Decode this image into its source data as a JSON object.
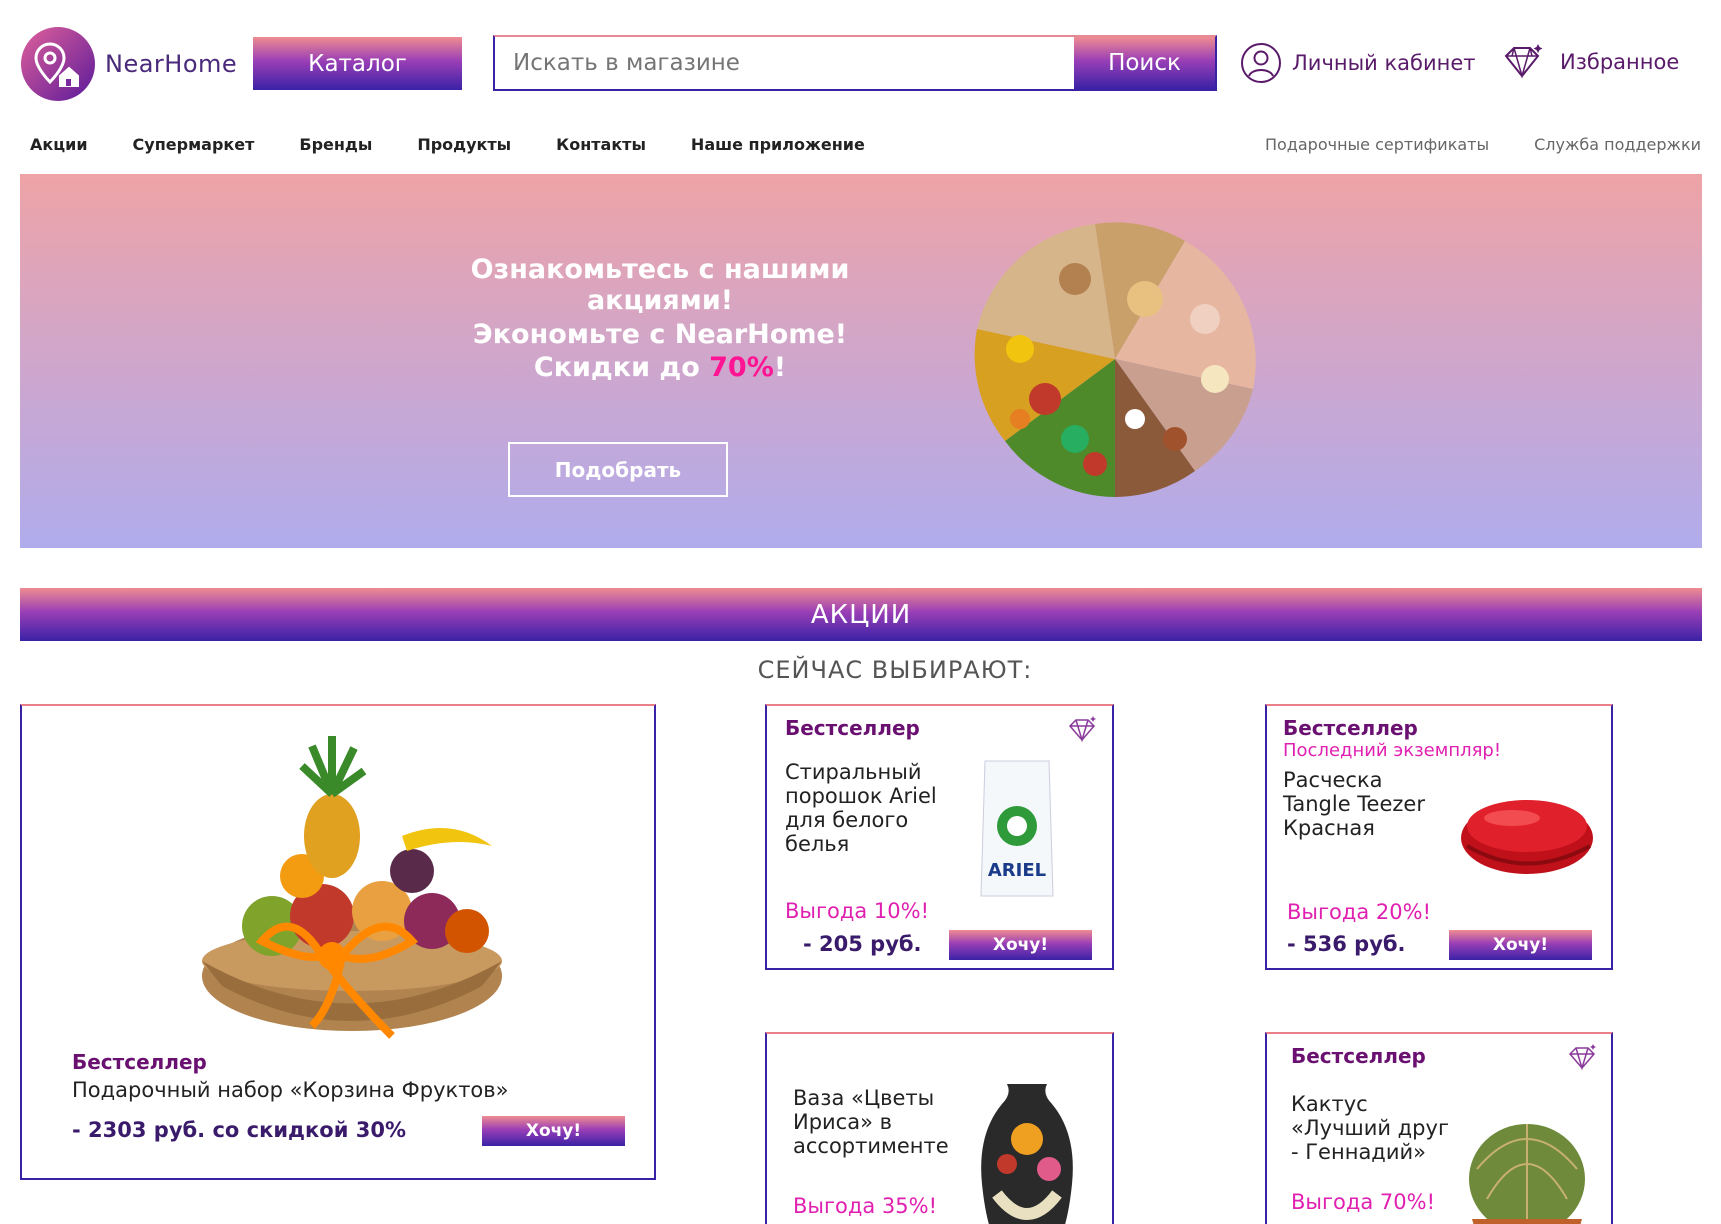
{
  "header": {
    "logo_text": "NearHome",
    "catalog_label": "Каталог",
    "search_placeholder": "Искать в магазине",
    "search_button": "Поиск",
    "account_label": "Личный кабинет",
    "favorites_label": "Избранное"
  },
  "nav": {
    "items": [
      "Акции",
      "Супермаркет",
      "Бренды",
      "Продукты",
      "Контакты",
      "Наше приложение"
    ],
    "right_items": [
      "Подарочные сертификаты",
      "Служба поддержки"
    ]
  },
  "banner": {
    "line1": "Ознакомьтесь с нашими акциями!",
    "line2": "Экономьте с NearHome!",
    "line3_prefix": "Скидки до ",
    "line3_highlight": "70%",
    "line3_suffix": "!",
    "button": "Подобрать"
  },
  "section": {
    "title": "АКЦИИ",
    "subtitle": "СЕЙЧАС ВЫБИРАЮТ:"
  },
  "cards": {
    "big": {
      "badge": "Бестселлер",
      "name": "Подарочный набор «Корзина Фруктов»",
      "price": "- 2303 руб. со скидкой 30%",
      "button": "Хочу!"
    },
    "ariel": {
      "badge": "Бестселлер",
      "name": "Стиральный порошок Ariel для белого белья",
      "benefit": "Выгода 10%!",
      "price": "- 205 руб.",
      "button": "Хочу!"
    },
    "brush": {
      "badge": "Бестселлер",
      "note": "Последний экземпляр!",
      "name": "Расческа Tangle Teezer Красная",
      "benefit": "Выгода 20%!",
      "price": "- 536 руб.",
      "button": "Хочу!"
    },
    "vase": {
      "name": "Ваза «Цветы Ириса» в ассортименте",
      "benefit": "Выгода 35%!"
    },
    "cactus": {
      "badge": "Бестселлер",
      "name": "Кактус «Лучший друг - Геннадий»",
      "benefit": "Выгода 70%!"
    }
  },
  "colors": {
    "brand_purple": "#3a22a6",
    "brand_pink": "#ef8c91",
    "accent_magenta": "#e020b0"
  }
}
